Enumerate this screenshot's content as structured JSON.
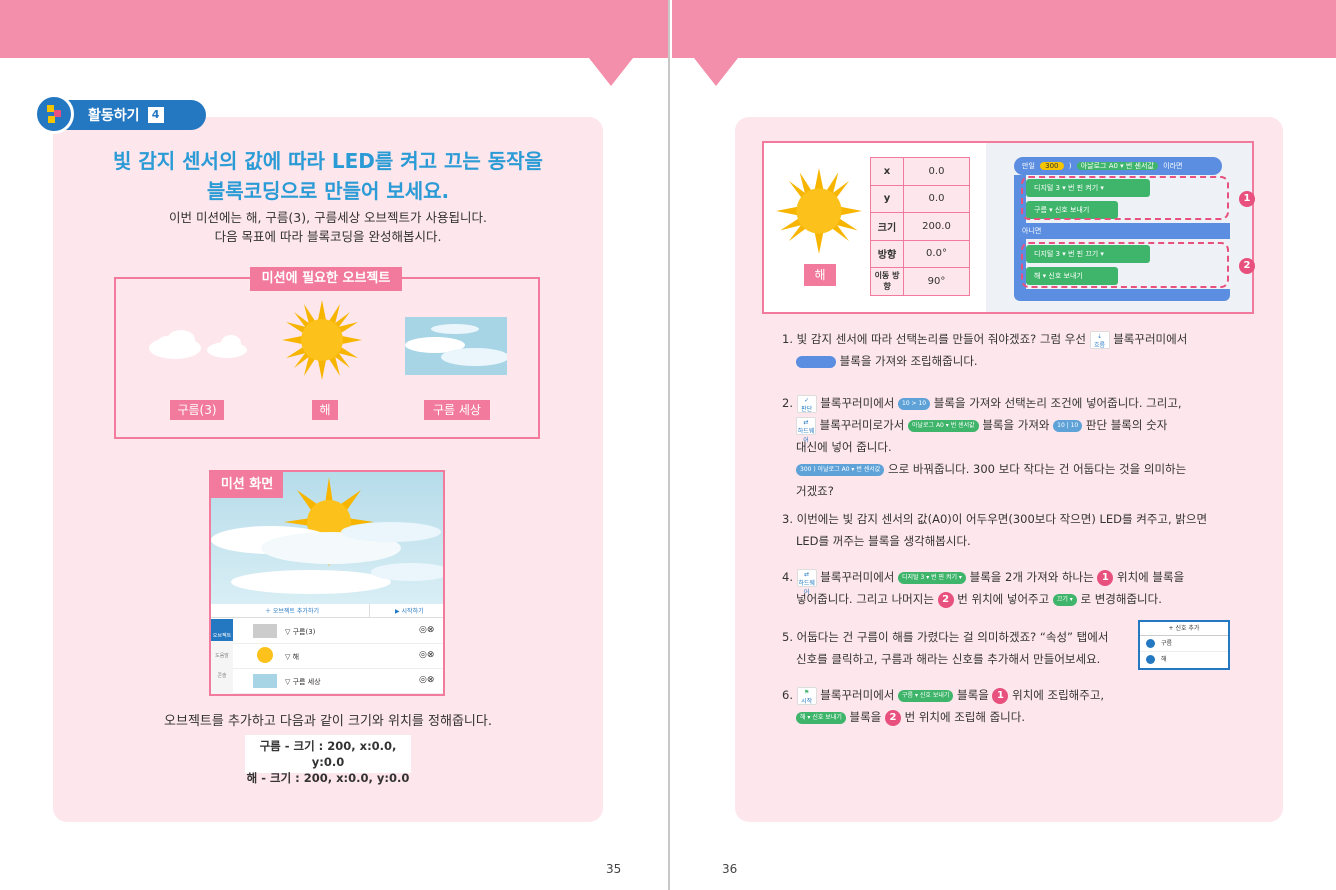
{
  "left": {
    "activity_label": "활동하기",
    "activity_num": "4",
    "title_line1": "빛 감지 센서의 값에 따라 LED를 켜고 끄는 동작을",
    "title_line2": "블록코딩으로 만들어 보세요.",
    "intro_line1": "이번 미션에는 해, 구름(3), 구름세상 오브젝트가 사용됩니다.",
    "intro_line2": "다음 목표에 따라 블록코딩을 완성해봅시다.",
    "objects_header": "미션에 필요한 오브젝트",
    "objects": [
      "구름(3)",
      "해",
      "구름 세상"
    ],
    "mission_header": "미션 화면",
    "mission_toolbar": {
      "add": "오브젝트 추가하기",
      "start": "시작하기"
    },
    "mission_rows": [
      "구름(3)",
      "해",
      "구름 세상"
    ],
    "mission_side": [
      "오브젝트",
      "도움말",
      "콘솔"
    ],
    "note": "오브젝트를 추가하고 다음과 같이 크기와 위치를 정해줍니다.",
    "size_line1": "구름 - 크기 : 200, x:0.0, y:0.0",
    "size_line2": "해  - 크기 : 200, x:0.0, y:0.0",
    "page_number": "35"
  },
  "right": {
    "sun_label": "해",
    "props": [
      {
        "k": "x",
        "v": "0.0"
      },
      {
        "k": "y",
        "v": "0.0"
      },
      {
        "k": "크기",
        "v": "200.0"
      },
      {
        "k": "방향",
        "v": "0.0°"
      },
      {
        "k": "이동 방향",
        "v": "90°"
      }
    ],
    "code": {
      "if": "만일",
      "num": "300",
      "op": ")",
      "analog": "아날로그 A0 ▾ 번 센서값",
      "then": "이라면",
      "digital1": "디지털 3 ▾ 번 핀 켜기 ▾",
      "signal1": "구름 ▾ 신호 보내기",
      "else": "아니면",
      "digital2": "디지털 3 ▾ 번 핀 끄기 ▾",
      "signal2": "해 ▾ 신호 보내기"
    },
    "markers": [
      "1",
      "2"
    ],
    "steps": [
      {
        "n": "1.",
        "a": "빛 감지 센서에 따라 선택논리를 만들어 줘야겠죠? 그럼 우선",
        "b": "블록꾸러미에서",
        "c": "블록을 가져와 조립해줍니다."
      },
      {
        "n": "2.",
        "a": "블록꾸러미에서",
        "b": "블록을 가져와 선택논리 조건에 넣어줍니다. 그리고,",
        "c": "블록꾸러미로가서",
        "d": "블록을 가져와",
        "e": "판단 블록의 숫자",
        "f": "대신에 넣어 줍니다.",
        "g": "으로 바꿔줍니다. 300 보다 작다는 건 어둡다는 것을 의미하는",
        "h": "거겠죠?"
      },
      {
        "n": "3.",
        "a": "이번에는 빛 감지 센서의 값(A0)이 어두우면(300보다 작으면) LED를 켜주고, 밝으면",
        "b": "LED를 꺼주는 블록을 생각해봅시다."
      },
      {
        "n": "4.",
        "a": "블록꾸러미에서",
        "b": "블록을 2개 가져와 하나는",
        "c": "위치에 블록을",
        "d": "넣어줍니다. 그리고 나머지는",
        "e": "번 위치에 넣어주고",
        "f": "로 변경해줍니다."
      },
      {
        "n": "5.",
        "a": "어둡다는 건 구름이 해를 가렸다는 걸 의미하겠죠? “속성” 탭에서",
        "b": "신호를 클릭하고, 구름과 해라는 신호를 추가해서 만들어보세요."
      },
      {
        "n": "6.",
        "a": "블록꾸러미에서",
        "b": "블록을",
        "c": "위치에 조립해주고,",
        "d": "블록을",
        "e": "번 위치에 조립해 줍니다."
      }
    ],
    "icons": {
      "flow": "흐름",
      "judge": "판단",
      "hardware": "하드웨어",
      "start": "시작"
    },
    "chips": {
      "off": "끄기 ▾",
      "digital": "디지털 3 ▾ 번 핀 켜기 ▾",
      "signal_cloud": "구름 ▾ 신호 보내기",
      "signal_sun": "해 ▾ 신호 보내기",
      "cmp": "10 > 10",
      "cmp2": "10 | 10",
      "cmp300": "300 ) 아날로그 A0 ▾ 번 센서값",
      "analog": "아날로그 A0 ▾ 번 센서값"
    },
    "signal_panel": {
      "add": "+ 신호 추가",
      "items": [
        "구름",
        "해"
      ]
    },
    "page_number": "36"
  },
  "colors": {
    "pink": "#f48fab",
    "panel": "#fde6ec",
    "blue": "#2478c2",
    "title": "#2b9bd6",
    "code_blue": "#5b8de0",
    "code_green": "#3fb56b"
  }
}
